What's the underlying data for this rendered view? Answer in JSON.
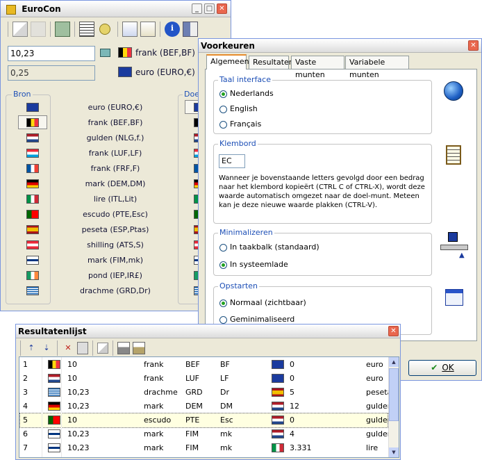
{
  "eurocon": {
    "title": "EuroCon",
    "amount_value": "10,23",
    "from_currency": "frank (BEF,BF)",
    "result_value": "0,25",
    "to_currency": "euro (EURO,€)",
    "source_label": "Bron",
    "target_label": "Doel",
    "currencies": [
      {
        "label": "euro (EURO,€)",
        "flag": "eu"
      },
      {
        "label": "frank (BEF,BF)",
        "flag": "be"
      },
      {
        "label": "gulden (NLG,f.)",
        "flag": "nl"
      },
      {
        "label": "frank (LUF,LF)",
        "flag": "lu"
      },
      {
        "label": "frank (FRF,F)",
        "flag": "fr"
      },
      {
        "label": "mark (DEM,DM)",
        "flag": "de"
      },
      {
        "label": "lire (ITL,Lit)",
        "flag": "it"
      },
      {
        "label": "escudo (PTE,Esc)",
        "flag": "pt"
      },
      {
        "label": "peseta (ESP,Ptas)",
        "flag": "es"
      },
      {
        "label": "shilling (ATS,S)",
        "flag": "at"
      },
      {
        "label": "mark (FIM,mk)",
        "flag": "fi"
      },
      {
        "label": "pond (IEP,IR£)",
        "flag": "ie"
      },
      {
        "label": "drachme (GRD,Dr)",
        "flag": "gr"
      }
    ]
  },
  "prefs": {
    "title": "Voorkeuren",
    "tabs": [
      "Algemeen",
      "Resultaten",
      "Vaste munten",
      "Variabele munten"
    ],
    "language_group": "Taal interface",
    "languages": [
      "Nederlands",
      "English",
      "Français"
    ],
    "clipboard_group": "Klembord",
    "clipboard_value": "EC",
    "clipboard_text": "Wanneer je bovenstaande letters gevolgd door een bedrag naar het klembord kopieërt (CTRL C of CTRL-X), wordt deze waarde automatisch omgezet naar de doel-munt. Meteen kan je deze nieuwe waarde plakken (CTRL-V).",
    "minimize_group": "Minimalizeren",
    "minimize_options": [
      "In taakbalk (standaard)",
      "In systeemlade"
    ],
    "startup_group": "Opstarten",
    "startup_options": [
      "Normaal (zichtbaar)",
      "Geminimaliseerd"
    ],
    "ok_label": "OK"
  },
  "results": {
    "title": "Resultatenlijst",
    "rows": [
      {
        "n": "1",
        "flag1": "be",
        "amount": "10",
        "name": "frank",
        "code": "BEF",
        "sym": "BF",
        "flag2": "eu",
        "result": "0",
        "target": "euro"
      },
      {
        "n": "2",
        "flag1": "nl",
        "amount": "10",
        "name": "frank",
        "code": "LUF",
        "sym": "LF",
        "flag2": "eu",
        "result": "0",
        "target": "euro"
      },
      {
        "n": "3",
        "flag1": "gr",
        "amount": "10,23",
        "name": "drachme",
        "code": "GRD",
        "sym": "Dr",
        "flag2": "es",
        "result": "5",
        "target": "peseta"
      },
      {
        "n": "4",
        "flag1": "de",
        "amount": "10,23",
        "name": "mark",
        "code": "DEM",
        "sym": "DM",
        "flag2": "nl",
        "result": "12",
        "target": "gulden"
      },
      {
        "n": "5",
        "flag1": "pt",
        "amount": "10",
        "name": "escudo",
        "code": "PTE",
        "sym": "Esc",
        "flag2": "nl",
        "result": "0",
        "target": "gulden"
      },
      {
        "n": "6",
        "flag1": "fi",
        "amount": "10,23",
        "name": "mark",
        "code": "FIM",
        "sym": "mk",
        "flag2": "nl",
        "result": "4",
        "target": "gulden"
      },
      {
        "n": "7",
        "flag1": "fi",
        "amount": "10,23",
        "name": "mark",
        "code": "FIM",
        "sym": "mk",
        "flag2": "it",
        "result": "3.331",
        "target": "lire"
      }
    ]
  }
}
